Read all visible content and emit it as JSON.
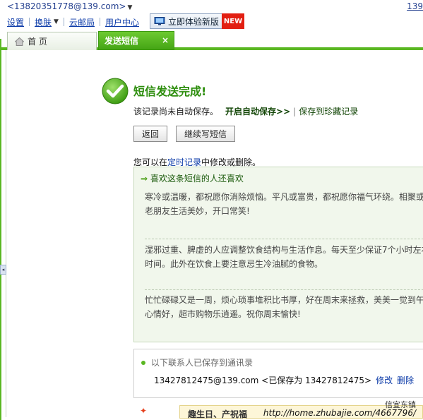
{
  "account": {
    "email": "<13820351778@139.com>",
    "right_link": "139"
  },
  "topnav": {
    "settings": "设置",
    "skin": "换肤",
    "post_office": "云邮局",
    "user_center": "用户中心"
  },
  "trial": {
    "label": "立即体验新版",
    "badge": "NEW"
  },
  "tabs": {
    "home": "首 页",
    "send_sms": "发送短信",
    "close": "×"
  },
  "result": {
    "title": "短信发送完成!",
    "not_saved": "该记录尚未自动保存。",
    "auto_save": "开启自动保存>>",
    "divider": "|",
    "save_favorites": "保存到珍藏记录"
  },
  "buttons": {
    "back": "返回",
    "continue": "继续写短信"
  },
  "modify": {
    "prefix": "您可以在",
    "link": "定时记录",
    "suffix": "中修改或删除。"
  },
  "recommend": {
    "heading": "喜欢这条短信的人还喜欢",
    "items": [
      {
        "line1": "寒冷或温暖，都祝愿你消除烦恼。平凡或富贵，都祝愿你福气环绕。相聚或",
        "line2": "老朋友生活美妙，开口常笑!"
      },
      {
        "line1": "湿邪过重、脾虚的人应调整饮食结构与生活作息。每天至少保证7个小时左右",
        "line2": "时间。此外在饮食上要注意忌生冷油腻的食物。"
      },
      {
        "line1": "忙忙碌碌又是一周，烦心琐事堆积比书厚，好在周末来拯救，美美一觉到午",
        "line2": "心情好，超市购物乐逍遥。祝你周末愉快!"
      }
    ]
  },
  "contacts": {
    "note": "以下联系人已保存到通讯录",
    "entry": "13427812475@139.com <已保存为 13427812475>",
    "edit": "修改",
    "delete": "删除"
  },
  "bottom": {
    "card_text": "趣生日、产祝福"
  },
  "watermark": {
    "line1": "信宜东镇",
    "line2": "http://home.zhubajie.com/4667796/"
  }
}
